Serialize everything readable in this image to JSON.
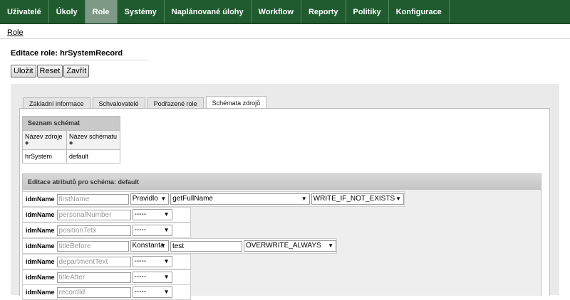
{
  "nav": [
    "Uživatelé",
    "Úkoly",
    "Role",
    "Systémy",
    "Naplánované úlohy",
    "Workflow",
    "Reporty",
    "Politiky",
    "Konfigurace"
  ],
  "breadcrumb": "Role",
  "page_title": "Editace role: hrSystemRecord",
  "buttons": {
    "save": "Uložit",
    "reset": "Reset",
    "close": "Zavřít"
  },
  "tabs": [
    "Základní informace",
    "Schvalovatelé",
    "Podřazené role",
    "Schémata zdrojů"
  ],
  "schemas": {
    "title": "Seznam schémat",
    "col1": "Název zdroje",
    "col2": "Název schématu",
    "row": {
      "resource": "hrSystem",
      "schema": "default"
    }
  },
  "attrs": {
    "title": "Editace atributů pro schéma: default",
    "label": "idmName",
    "rows": [
      {
        "placeholder": "firstName",
        "type": "Pravidlo",
        "value": "getFullName",
        "mode": "WRITE_IF_NOT_EXISTS"
      },
      {
        "placeholder": "personalNumber",
        "type": "-----"
      },
      {
        "placeholder": "positionTetx",
        "type": "-----"
      },
      {
        "placeholder": "titleBefore",
        "type": "Konstanta",
        "value": "test",
        "mode": "OVERWRITE_ALWAYS"
      },
      {
        "placeholder": "departmentText",
        "type": "-----"
      },
      {
        "placeholder": "titleAfter",
        "type": "-----"
      },
      {
        "placeholder": "recordId",
        "type": "-----"
      }
    ]
  },
  "active_nav": "Role",
  "active_tab": "Schémata zdrojů",
  "colors": {
    "nav_bg": "#1f5b2e",
    "nav_active": "#7e9a86"
  }
}
